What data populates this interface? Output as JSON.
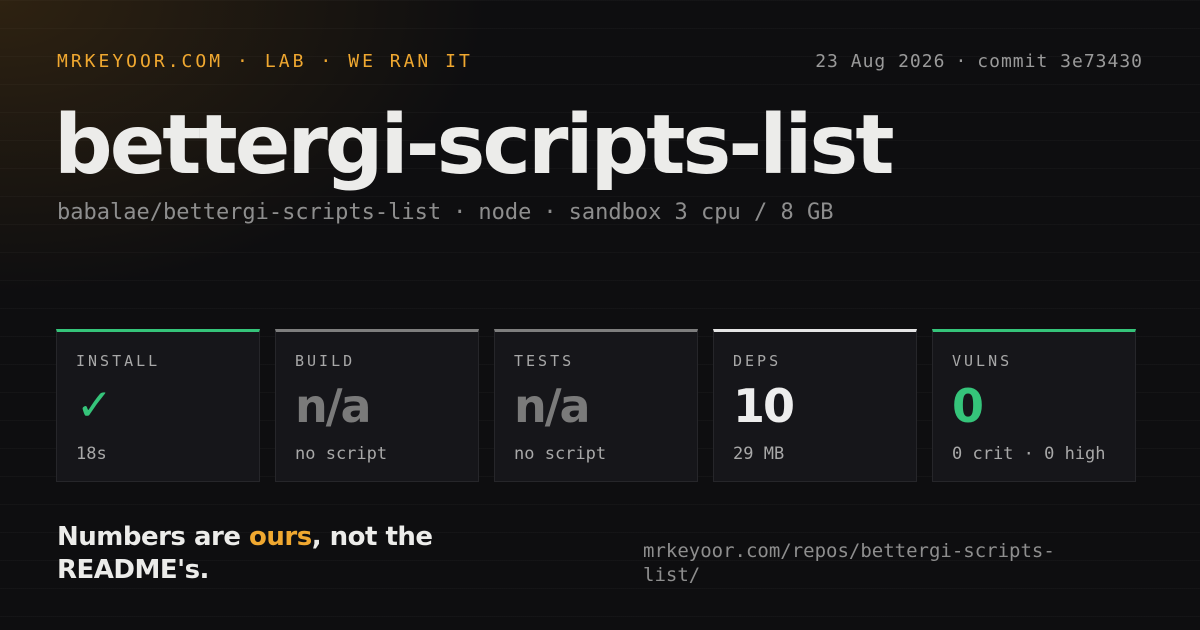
{
  "header": {
    "brand_parts": [
      "MRKEYOOR.COM",
      "LAB",
      "WE RAN IT"
    ],
    "separator": "·",
    "date": "23 Aug 2026",
    "commit": "commit 3e73430"
  },
  "title": "bettergi-scripts-list",
  "subtitle": {
    "repo": "babalae/bettergi-scripts-list",
    "runtime": "node",
    "sandbox": "sandbox 3 cpu / 8 GB"
  },
  "cards": [
    {
      "label": "INSTALL",
      "value": "✓",
      "note": "18s",
      "accent": "#35c47a",
      "value_color": "#35c47a",
      "icon": "check-icon"
    },
    {
      "label": "BUILD",
      "value": "n/a",
      "note": "no script",
      "accent": "#7e7e7e",
      "value_color": "#7a7a7a"
    },
    {
      "label": "TESTS",
      "value": "n/a",
      "note": "no script",
      "accent": "#7e7e7e",
      "value_color": "#7a7a7a"
    },
    {
      "label": "DEPS",
      "value": "10",
      "note": "29 MB",
      "accent": "#e5e5e5",
      "value_color": "#ededed"
    },
    {
      "label": "VULNS",
      "value": "0",
      "note": "0 crit · 0 high",
      "accent": "#35c47a",
      "value_color": "#35c47a"
    }
  ],
  "tagline": {
    "before": "Numbers are ",
    "highlight": "ours",
    "after": ", not the README's."
  },
  "url": "mrkeyoor.com/repos/bettergi-scripts-list/",
  "colors": {
    "accent": "#f0a830",
    "success": "#35c47a",
    "background": "#0e0e10"
  }
}
